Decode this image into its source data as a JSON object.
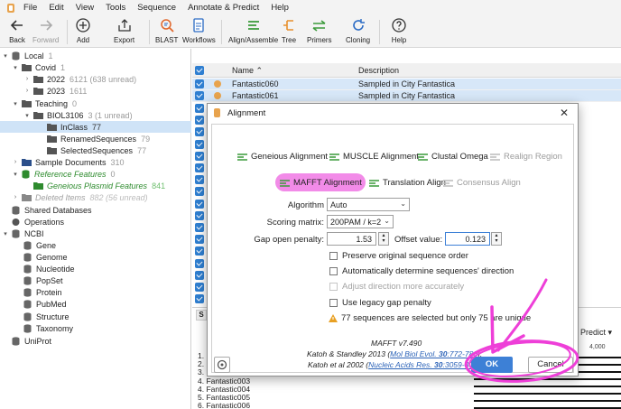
{
  "menubar": [
    "File",
    "Edit",
    "View",
    "Tools",
    "Sequence",
    "Annotate & Predict",
    "Help"
  ],
  "toolbar": {
    "back": "Back",
    "forward": "Forward",
    "add": "Add",
    "export": "Export",
    "blast": "BLAST",
    "workflows": "Workflows",
    "align": "Align/Assemble",
    "tree": "Tree",
    "primers": "Primers",
    "cloning": "Cloning",
    "help": "Help"
  },
  "sidebar": {
    "local": {
      "label": "Local",
      "count": "1"
    },
    "covid": {
      "label": "Covid",
      "count": "1"
    },
    "y2022": {
      "label": "2022",
      "count": "6121 (638 unread)"
    },
    "y2023": {
      "label": "2023",
      "count": "1611"
    },
    "teaching": {
      "label": "Teaching",
      "count": "0"
    },
    "biol": {
      "label": "BIOL3106",
      "count": "3 (1 unread)"
    },
    "inclass": {
      "label": "InClass",
      "count": "77"
    },
    "renamed": {
      "label": "RenamedSequences",
      "count": "79"
    },
    "selected": {
      "label": "SelectedSequences",
      "count": "77"
    },
    "sample": {
      "label": "Sample Documents",
      "count": "310"
    },
    "reference": {
      "label": "Reference Features",
      "count": "0"
    },
    "plasmid": {
      "label": "Geneious Plasmid Features",
      "count": "841"
    },
    "deleted": {
      "label": "Deleted Items",
      "count": "882 (56 unread)"
    },
    "shared": {
      "label": "Shared Databases"
    },
    "operations": {
      "label": "Operations"
    },
    "ncbi": {
      "label": "NCBI"
    },
    "ncbi_items": [
      "Gene",
      "Genome",
      "Nucleotide",
      "PopSet",
      "Protein",
      "PubMed",
      "Structure",
      "Taxonomy"
    ],
    "uniprot": {
      "label": "UniProt"
    }
  },
  "table": {
    "col_name": "Name",
    "col_desc": "Description",
    "rows": [
      {
        "name": "Fantastic060",
        "desc": "Sampled in City Fantastica"
      },
      {
        "name": "Fantastic061",
        "desc": "Sampled in City Fantastica"
      }
    ]
  },
  "lower": {
    "tab_s": "S",
    "predict_label": "Predict",
    "ruler_value": "4,000",
    "seq_list": [
      "1.",
      "2.",
      "3.",
      "4. Fantastic003",
      "4. Fantastic004",
      "5. Fantastic005",
      "6. Fantastic006"
    ]
  },
  "dialog": {
    "title": "Alignment",
    "options": {
      "geneious": "Geneious Alignment",
      "muscle": "MUSCLE Alignment",
      "clustal": "Clustal Omega",
      "realign": "Realign Region",
      "mafft": "MAFFT Alignment",
      "translation": "Translation Align",
      "consensus": "Consensus Align"
    },
    "algorithm_label": "Algorithm",
    "algorithm_value": "Auto",
    "scoring_label": "Scoring matrix:",
    "scoring_value": "200PAM / k=2",
    "gap_label": "Gap open penalty:",
    "gap_value": "1.53",
    "offset_label": "Offset value:",
    "offset_value": "0.123",
    "checkboxes": {
      "preserve": "Preserve original sequence order",
      "auto_dir": "Automatically determine sequences' direction",
      "adjust": "Adjust direction more accurately",
      "legacy": "Use legacy gap penalty"
    },
    "warning": "77 sequences are selected but only 75 are unique",
    "version": "MAFFT v7.490",
    "cite1_prefix": "Katoh & Standley 2013 (",
    "cite1_link_a": "Mol Biol Evol. ",
    "cite1_link_b": "30",
    "cite1_link_c": ":772-780",
    "cite1_suffix": ").",
    "cite2_prefix": "Katoh et al 2002 (",
    "cite2_link_a": "Nucleic Acids Res. ",
    "cite2_link_b": "30",
    "cite2_link_c": ":3059-3066",
    "cite2_suffix": ")",
    "ok": "OK",
    "cancel": "Cancel"
  },
  "colors": {
    "accent": "#3d80d6",
    "highlight": "#f28be8",
    "annotation": "#ee3fd8",
    "selection": "#cfe3f7",
    "green_text": "#2e8b2e"
  },
  "icons": [
    "app-icon",
    "back-arrow-icon",
    "forward-arrow-icon",
    "add-plus-icon",
    "export-icon",
    "blast-icon",
    "workflows-icon",
    "align-icon",
    "tree-icon",
    "primers-icon",
    "cloning-icon",
    "help-icon",
    "folder-icon",
    "database-icon",
    "flag-icon",
    "warning-icon",
    "gear-icon",
    "close-icon"
  ]
}
